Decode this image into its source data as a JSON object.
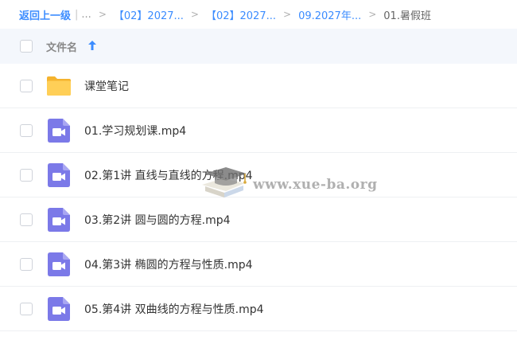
{
  "breadcrumb": {
    "back_label": "返回上一级",
    "pipe": "|",
    "ellipsis": "...",
    "separator": ">",
    "items": [
      {
        "label": "【02】2027..."
      },
      {
        "label": "【02】2027..."
      },
      {
        "label": "09.2027年..."
      }
    ],
    "current": "01.暑假班"
  },
  "list_header": {
    "name_label": "文件名",
    "sort": "ascending",
    "sort_icon": "arrow-up-icon"
  },
  "files": [
    {
      "name": "课堂笔记",
      "type": "folder",
      "icon": "folder-icon"
    },
    {
      "name": "01.学习规划课.mp4",
      "type": "video",
      "icon": "video-file-icon"
    },
    {
      "name": "02.第1讲 直线与直线的方程.mp4",
      "type": "video",
      "icon": "video-file-icon"
    },
    {
      "name": "03.第2讲 圆与圆的方程.mp4",
      "type": "video",
      "icon": "video-file-icon"
    },
    {
      "name": "04.第3讲 椭圆的方程与性质.mp4",
      "type": "video",
      "icon": "video-file-icon"
    },
    {
      "name": "05.第4讲 双曲线的方程与性质.mp4",
      "type": "video",
      "icon": "video-file-icon"
    }
  ],
  "watermark": {
    "text": "www.xue-ba.org",
    "icon": "graduation-cap-icon"
  },
  "colors": {
    "link": "#3b8cff",
    "header_bg": "#f4f7fc",
    "folder": "#ffc94d",
    "video": "#7b79e8"
  }
}
